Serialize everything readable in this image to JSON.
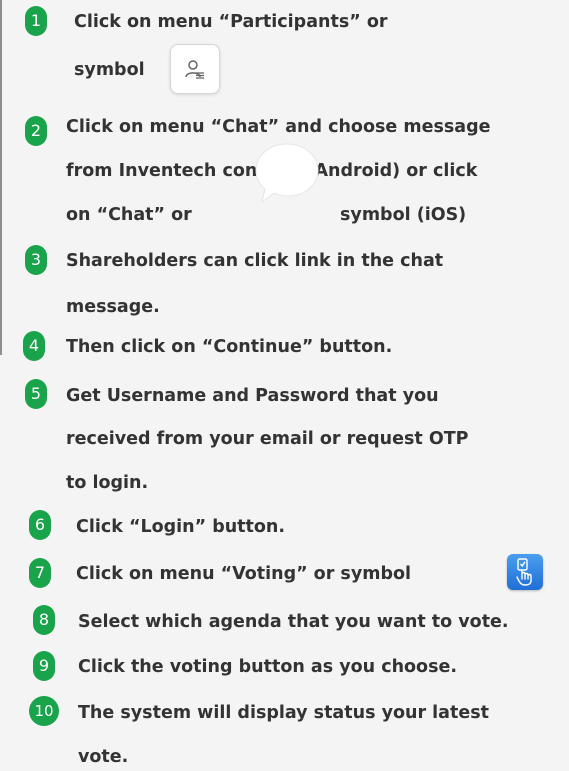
{
  "colors": {
    "badge_green": "#19a34a",
    "text": "#333333",
    "background": "#f4f4f4",
    "voting_icon_blue": "#2a7fe3"
  },
  "icons": {
    "participants": "participants-icon",
    "chat": "chat-bubble-icon",
    "voting": "voting-hand-icon"
  },
  "steps": [
    {
      "number": "1",
      "lines": [
        "Click on menu “Participants” or",
        "symbol"
      ]
    },
    {
      "number": "2",
      "lines": [
        "Click on menu “Chat” and choose message",
        "from Inventech connect (Android) or click",
        "on “Chat” or",
        "symbol (iOS)"
      ]
    },
    {
      "number": "3",
      "lines": [
        "Shareholders can click link in the chat",
        "message."
      ]
    },
    {
      "number": "4",
      "lines": [
        "Then click on “Continue” button."
      ]
    },
    {
      "number": "5",
      "lines": [
        "Get Username and Password that you",
        "received from your email or request OTP",
        "to login."
      ]
    },
    {
      "number": "6",
      "lines": [
        "Click “Login” button."
      ]
    },
    {
      "number": "7",
      "lines": [
        "Click on menu “Voting” or symbol"
      ]
    },
    {
      "number": "8",
      "lines": [
        "Select which agenda that you want to vote."
      ]
    },
    {
      "number": "9",
      "lines": [
        "Click the voting button as you choose."
      ]
    },
    {
      "number": "10",
      "lines": [
        "The system will display status your latest",
        "vote."
      ]
    }
  ]
}
